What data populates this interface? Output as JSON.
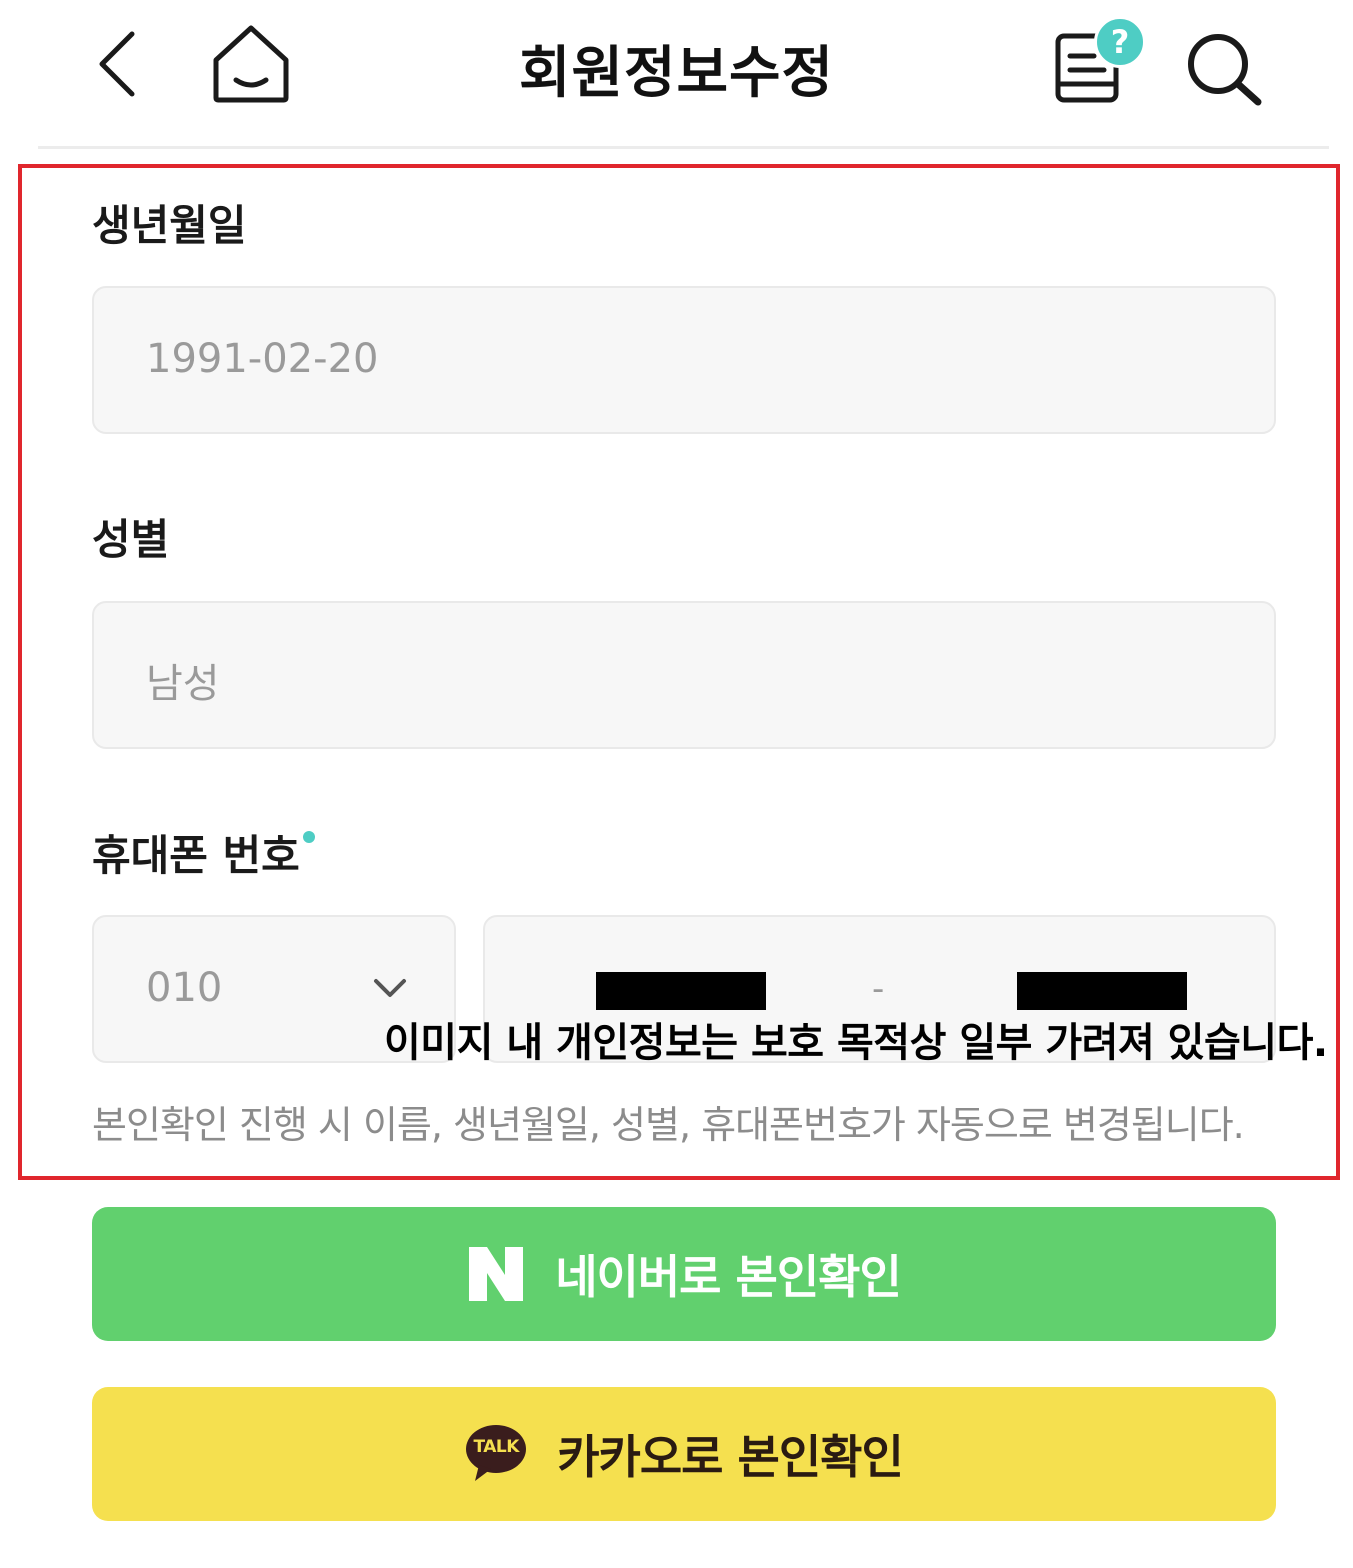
{
  "header": {
    "title": "회원정보수정",
    "back_icon": "chevron-left-icon",
    "home_icon": "home-icon",
    "help_icon": "help-document-icon",
    "help_badge": "?",
    "search_icon": "search-icon"
  },
  "form": {
    "birth": {
      "label": "생년월일",
      "value": "1991-02-20"
    },
    "gender": {
      "label": "성별",
      "value": "남성"
    },
    "phone": {
      "label": "휴대폰 번호",
      "prefix": "010",
      "separator": "-",
      "required_color": "#4ecdc4"
    },
    "helper": "본인확인 진행 시 이름, 생년월일, 성별, 휴대폰번호가 자동으로 변경됩니다."
  },
  "privacy_notice": "이미지 내 개인정보는 보호 목적상 일부 가려져 있습니다.",
  "buttons": {
    "naver": {
      "logo": "N",
      "label": "네이버로 본인확인",
      "color": "#61d06e"
    },
    "kakao": {
      "logo": "TALK",
      "label": "카카오로 본인확인",
      "color": "#f5e04f"
    }
  },
  "colors": {
    "highlight": "#e0262d",
    "accent": "#4ecdc4"
  }
}
